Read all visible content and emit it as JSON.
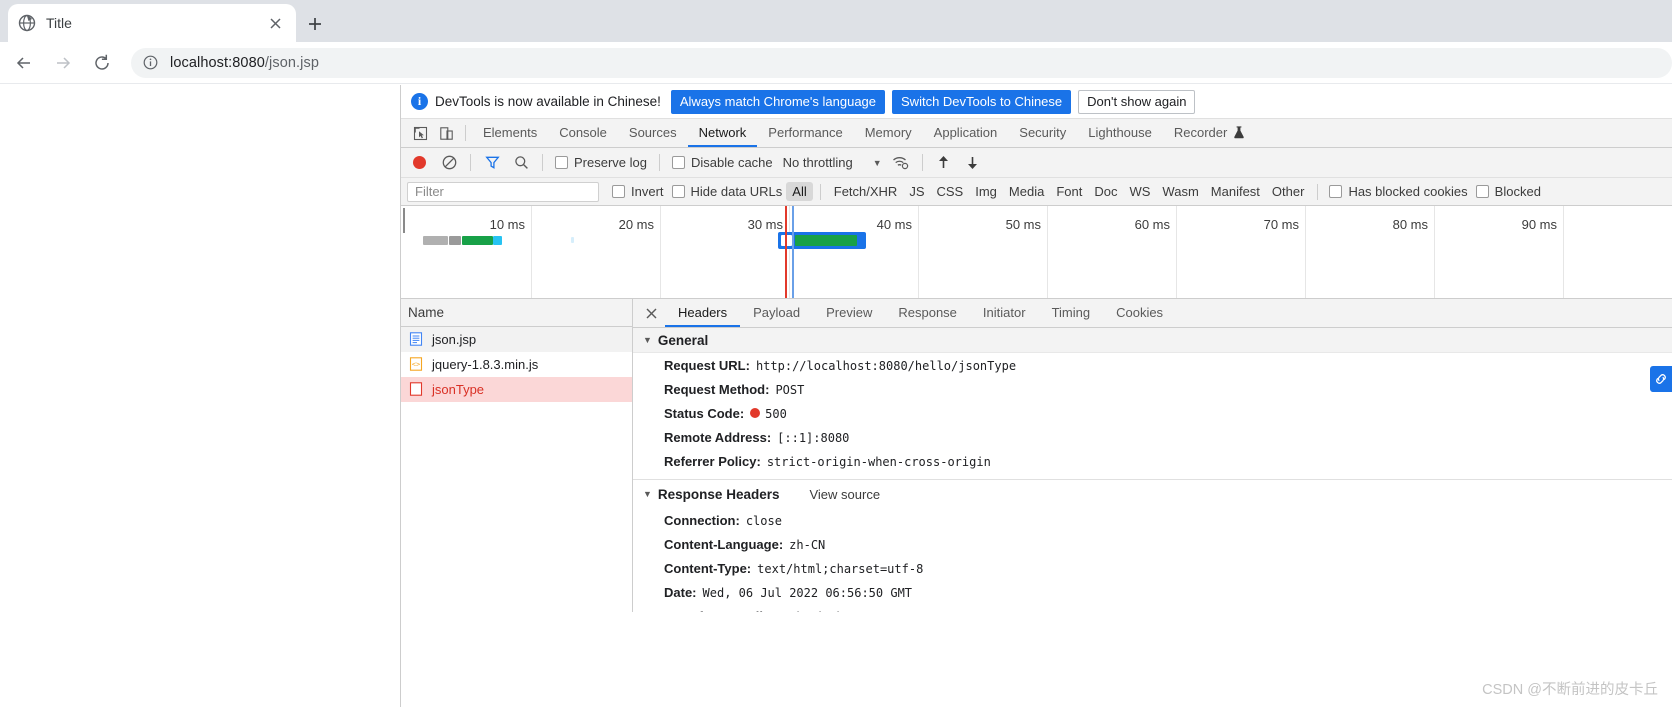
{
  "browser": {
    "tab": {
      "title": "Title",
      "favicon_icon": "globe-icon",
      "close_icon": "close-icon"
    },
    "new_tab_label": "+",
    "nav": {
      "back_icon": "arrow-left-icon",
      "forward_icon": "arrow-right-icon",
      "reload_icon": "reload-icon"
    },
    "omnibox": {
      "info_icon": "info-circle-icon",
      "url_host": "localhost:8080",
      "url_path": "/json.jsp"
    }
  },
  "devtools": {
    "banner": {
      "icon": "info-icon",
      "message": "DevTools is now available in Chinese!",
      "btn_always_match": "Always match Chrome's language",
      "btn_switch": "Switch DevTools to Chinese",
      "btn_dismiss": "Don't show again"
    },
    "tool_icons": [
      "inspect-icon",
      "device-toggle-icon"
    ],
    "tabs": [
      {
        "label": "Elements",
        "active": false
      },
      {
        "label": "Console",
        "active": false
      },
      {
        "label": "Sources",
        "active": false
      },
      {
        "label": "Network",
        "active": true
      },
      {
        "label": "Performance",
        "active": false
      },
      {
        "label": "Memory",
        "active": false
      },
      {
        "label": "Application",
        "active": false
      },
      {
        "label": "Security",
        "active": false
      },
      {
        "label": "Lighthouse",
        "active": false
      },
      {
        "label": "Recorder",
        "active": false
      }
    ],
    "recorder_flask_icon": "flask-icon",
    "network_toolbar": {
      "record_icon": "record-stop-icon",
      "clear_icon": "clear-icon",
      "filter_icon": "funnel-icon",
      "search_icon": "search-icon",
      "preserve_log": "Preserve log",
      "disable_cache": "Disable cache",
      "throttling": "No throttling",
      "throttle_caret_icon": "chevron-down-icon",
      "wifi_icon": "network-conditions-icon",
      "import_icon": "upload-har-icon",
      "export_icon": "download-har-icon"
    },
    "filter_bar": {
      "filter_placeholder": "Filter",
      "invert": "Invert",
      "hide_data_urls": "Hide data URLs",
      "types": [
        "All",
        "Fetch/XHR",
        "JS",
        "CSS",
        "Img",
        "Media",
        "Font",
        "Doc",
        "WS",
        "Wasm",
        "Manifest",
        "Other"
      ],
      "active_type": "All",
      "has_blocked_cookies": "Has blocked cookies",
      "blocked": "Blocked"
    },
    "overview": {
      "ticks": [
        "10 ms",
        "20 ms",
        "30 ms",
        "40 ms",
        "50 ms",
        "60 ms",
        "70 ms",
        "80 ms",
        "90 ms"
      ],
      "dclevent_color": "#0d5fd4",
      "loadevent_color": "#e2392b"
    },
    "requests": {
      "column_header": "Name",
      "rows": [
        {
          "name": "json.jsp",
          "icon": "document-icon",
          "state": "alt"
        },
        {
          "name": "jquery-1.8.3.min.js",
          "icon": "script-icon",
          "state": "normal"
        },
        {
          "name": "jsonType",
          "icon": "xhr-error-icon",
          "state": "err"
        }
      ]
    },
    "detail": {
      "close_icon": "close-icon",
      "tabs": [
        {
          "label": "Headers",
          "active": true
        },
        {
          "label": "Payload",
          "active": false
        },
        {
          "label": "Preview",
          "active": false
        },
        {
          "label": "Response",
          "active": false
        },
        {
          "label": "Initiator",
          "active": false
        },
        {
          "label": "Timing",
          "active": false
        },
        {
          "label": "Cookies",
          "active": false
        }
      ],
      "general": {
        "title": "General",
        "rows": [
          {
            "key": "Request URL:",
            "value": "http://localhost:8080/hello/jsonType"
          },
          {
            "key": "Request Method:",
            "value": "POST"
          },
          {
            "key": "Status Code:",
            "value": "500",
            "status_dot": true
          },
          {
            "key": "Remote Address:",
            "value": "[::1]:8080"
          },
          {
            "key": "Referrer Policy:",
            "value": "strict-origin-when-cross-origin"
          }
        ]
      },
      "response_headers": {
        "title": "Response Headers",
        "view_source": "View source",
        "rows": [
          {
            "key": "Connection:",
            "value": "close"
          },
          {
            "key": "Content-Language:",
            "value": "zh-CN"
          },
          {
            "key": "Content-Type:",
            "value": "text/html;charset=utf-8"
          },
          {
            "key": "Date:",
            "value": "Wed, 06 Jul 2022 06:56:50 GMT"
          },
          {
            "key": "Transfer-Encoding:",
            "value": "chunked"
          }
        ]
      }
    },
    "edge_badge_icon": "link-icon"
  },
  "watermark": "CSDN @不断前进的皮卡丘"
}
